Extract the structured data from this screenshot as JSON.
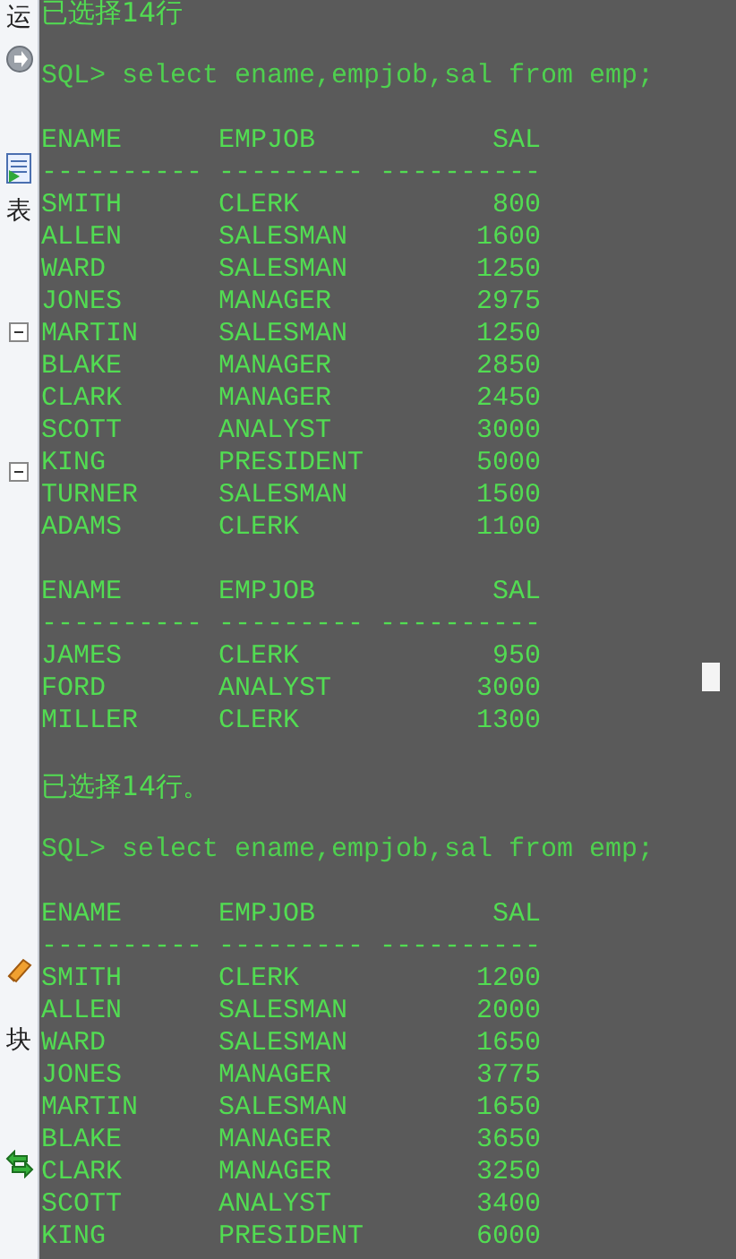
{
  "ide_strip": {
    "labels": [
      "运",
      "表",
      "块"
    ]
  },
  "console": {
    "cursor": true,
    "lines": [
      {
        "kind": "message",
        "text": "已选择14行"
      },
      {
        "kind": "blank"
      },
      {
        "kind": "prompt",
        "text": "SQL> select ename,empjob,sal from emp;"
      },
      {
        "kind": "blank"
      },
      {
        "kind": "header",
        "cells": [
          "ENAME",
          "EMPJOB",
          "SAL"
        ]
      },
      {
        "kind": "rule",
        "cells": [
          "----------",
          "---------",
          "----------"
        ]
      },
      {
        "kind": "row",
        "cells": [
          "SMITH",
          "CLERK",
          "800"
        ]
      },
      {
        "kind": "row",
        "cells": [
          "ALLEN",
          "SALESMAN",
          "1600"
        ]
      },
      {
        "kind": "row",
        "cells": [
          "WARD",
          "SALESMAN",
          "1250"
        ]
      },
      {
        "kind": "row",
        "cells": [
          "JONES",
          "MANAGER",
          "2975"
        ]
      },
      {
        "kind": "row",
        "cells": [
          "MARTIN",
          "SALESMAN",
          "1250"
        ]
      },
      {
        "kind": "row",
        "cells": [
          "BLAKE",
          "MANAGER",
          "2850"
        ]
      },
      {
        "kind": "row",
        "cells": [
          "CLARK",
          "MANAGER",
          "2450"
        ]
      },
      {
        "kind": "row",
        "cells": [
          "SCOTT",
          "ANALYST",
          "3000"
        ]
      },
      {
        "kind": "row",
        "cells": [
          "KING",
          "PRESIDENT",
          "5000"
        ]
      },
      {
        "kind": "row",
        "cells": [
          "TURNER",
          "SALESMAN",
          "1500"
        ]
      },
      {
        "kind": "row",
        "cells": [
          "ADAMS",
          "CLERK",
          "1100"
        ]
      },
      {
        "kind": "blank"
      },
      {
        "kind": "header",
        "cells": [
          "ENAME",
          "EMPJOB",
          "SAL"
        ]
      },
      {
        "kind": "rule",
        "cells": [
          "----------",
          "---------",
          "----------"
        ]
      },
      {
        "kind": "row",
        "cells": [
          "JAMES",
          "CLERK",
          "950"
        ]
      },
      {
        "kind": "row",
        "cells": [
          "FORD",
          "ANALYST",
          "3000"
        ]
      },
      {
        "kind": "row",
        "cells": [
          "MILLER",
          "CLERK",
          "1300"
        ]
      },
      {
        "kind": "blank"
      },
      {
        "kind": "message",
        "text": "已选择14行。"
      },
      {
        "kind": "blank"
      },
      {
        "kind": "prompt",
        "text": "SQL> select ename,empjob,sal from emp;"
      },
      {
        "kind": "blank"
      },
      {
        "kind": "header",
        "cells": [
          "ENAME",
          "EMPJOB",
          "SAL"
        ]
      },
      {
        "kind": "rule",
        "cells": [
          "----------",
          "---------",
          "----------"
        ]
      },
      {
        "kind": "row",
        "cells": [
          "SMITH",
          "CLERK",
          "1200"
        ]
      },
      {
        "kind": "row",
        "cells": [
          "ALLEN",
          "SALESMAN",
          "2000"
        ]
      },
      {
        "kind": "row",
        "cells": [
          "WARD",
          "SALESMAN",
          "1650"
        ]
      },
      {
        "kind": "row",
        "cells": [
          "JONES",
          "MANAGER",
          "3775"
        ]
      },
      {
        "kind": "row",
        "cells": [
          "MARTIN",
          "SALESMAN",
          "1650"
        ]
      },
      {
        "kind": "row",
        "cells": [
          "BLAKE",
          "MANAGER",
          "3650"
        ]
      },
      {
        "kind": "row",
        "cells": [
          "CLARK",
          "MANAGER",
          "3250"
        ]
      },
      {
        "kind": "row",
        "cells": [
          "SCOTT",
          "ANALYST",
          "3400"
        ]
      },
      {
        "kind": "row",
        "cells": [
          "KING",
          "PRESIDENT",
          "6000"
        ]
      }
    ]
  }
}
